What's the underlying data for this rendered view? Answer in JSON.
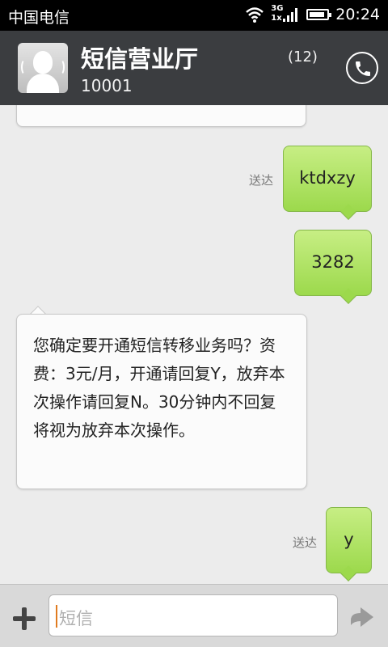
{
  "status_bar": {
    "carrier": "中国电信",
    "network_top": "3G",
    "network_bottom": "1x",
    "time": "20:24",
    "battery_level": 0.9
  },
  "header": {
    "contact_name": "短信营业厅",
    "contact_number": "10001",
    "message_count": "(12)"
  },
  "messages": [
    {
      "direction": "incoming",
      "text": ""
    },
    {
      "direction": "outgoing",
      "text": "ktdxzy",
      "status": "送达"
    },
    {
      "direction": "outgoing",
      "text": "3282",
      "status": ""
    },
    {
      "direction": "incoming",
      "text": "您确定要开通短信转移业务吗？资费：3元/月，开通请回复Y，放弃本次操作请回复N。30分钟内不回复将视为放弃本次操作。"
    },
    {
      "direction": "outgoing",
      "text": "y",
      "status": "送达"
    }
  ],
  "compose": {
    "placeholder": "短信"
  },
  "icons": {
    "wifi": "wifi-icon",
    "signal": "signal-icon",
    "battery": "battery-icon",
    "call": "phone-icon",
    "add": "plus-icon",
    "send": "send-arrow-icon"
  }
}
